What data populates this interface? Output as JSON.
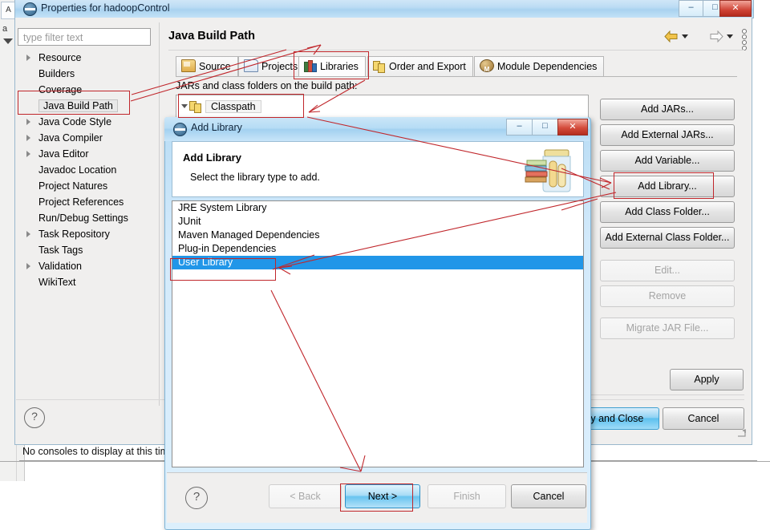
{
  "background": {
    "left_tab_label": "A",
    "left_text": "a"
  },
  "properties_window": {
    "title": "Properties for hadoopControl",
    "window_buttons": {
      "minimize": "–",
      "maximize": "□",
      "close": "✕"
    },
    "filter": {
      "placeholder": "type filter text",
      "value": ""
    },
    "tree": [
      {
        "label": "Resource",
        "expandable": true,
        "selected": false
      },
      {
        "label": "Builders",
        "expandable": false,
        "selected": false
      },
      {
        "label": "Coverage",
        "expandable": false,
        "selected": false
      },
      {
        "label": "Java Build Path",
        "expandable": false,
        "selected": true
      },
      {
        "label": "Java Code Style",
        "expandable": true,
        "selected": false
      },
      {
        "label": "Java Compiler",
        "expandable": true,
        "selected": false
      },
      {
        "label": "Java Editor",
        "expandable": true,
        "selected": false
      },
      {
        "label": "Javadoc Location",
        "expandable": false,
        "selected": false
      },
      {
        "label": "Project Natures",
        "expandable": false,
        "selected": false
      },
      {
        "label": "Project References",
        "expandable": false,
        "selected": false
      },
      {
        "label": "Run/Debug Settings",
        "expandable": false,
        "selected": false
      },
      {
        "label": "Task Repository",
        "expandable": true,
        "selected": false
      },
      {
        "label": "Task Tags",
        "expandable": false,
        "selected": false
      },
      {
        "label": "Validation",
        "expandable": true,
        "selected": false
      },
      {
        "label": "WikiText",
        "expandable": false,
        "selected": false
      }
    ],
    "page_title": "Java Build Path",
    "tabs": [
      {
        "label": "Source",
        "icon": "source-folder-icon",
        "active": false
      },
      {
        "label": "Projects",
        "icon": "project-folder-icon",
        "active": false
      },
      {
        "label": "Libraries",
        "icon": "libraries-books-icon",
        "active": true
      },
      {
        "label": "Order and Export",
        "icon": "order-export-icon",
        "active": false
      },
      {
        "label": "Module Dependencies",
        "icon": "module-icon",
        "active": false
      }
    ],
    "jars_label": "JARs and class folders on the build path:",
    "classpath_tree": [
      {
        "label": "Classpath",
        "icon": "classpath-icon",
        "expanded": true
      }
    ],
    "side_buttons": [
      {
        "label": "Add JARs...",
        "enabled": true
      },
      {
        "label": "Add External JARs...",
        "enabled": true
      },
      {
        "label": "Add Variable...",
        "enabled": true
      },
      {
        "label": "Add Library...",
        "enabled": true
      },
      {
        "label": "Add Class Folder...",
        "enabled": true
      },
      {
        "label": "Add External Class Folder...",
        "enabled": true
      },
      {
        "label": "Edit...",
        "enabled": false
      },
      {
        "label": "Remove",
        "enabled": false
      },
      {
        "label": "Migrate JAR File...",
        "enabled": false
      }
    ],
    "apply_label": "Apply",
    "apply_and_close_label": "ly and Close",
    "cancel_label": "Cancel",
    "help_label": "?"
  },
  "console_status": "No consoles to display at this tim",
  "add_library_dialog": {
    "window_title": "Add Library",
    "window_buttons": {
      "minimize": "–",
      "maximize": "□",
      "close": "✕"
    },
    "header_title": "Add Library",
    "header_subtitle": "Select the library type to add.",
    "header_icon": "library-jar-books-icon",
    "library_types": [
      {
        "label": "JRE System Library",
        "selected": false
      },
      {
        "label": "JUnit",
        "selected": false
      },
      {
        "label": "Maven Managed Dependencies",
        "selected": false
      },
      {
        "label": "Plug-in Dependencies",
        "selected": false
      },
      {
        "label": "User Library",
        "selected": true
      }
    ],
    "help_label": "?",
    "buttons": [
      {
        "label": "< Back",
        "state": "disabled"
      },
      {
        "label": "Next >",
        "state": "primary"
      },
      {
        "label": "Finish",
        "state": "disabled"
      },
      {
        "label": "Cancel",
        "state": "normal"
      }
    ]
  },
  "annotations": {
    "color": "#c0262b",
    "highlight_boxes": [
      "Java Build Path",
      "Libraries",
      "Classpath",
      "Add Library...",
      "User Library",
      "Next >"
    ]
  }
}
